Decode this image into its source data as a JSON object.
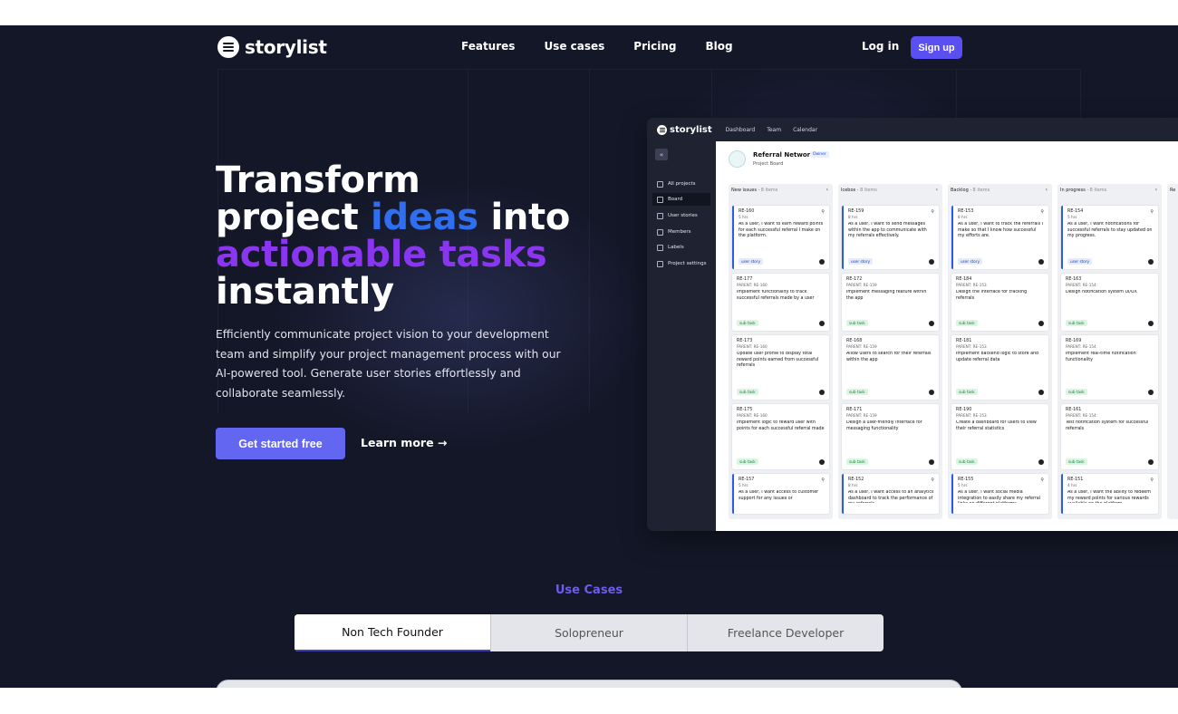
{
  "brand": {
    "name": "storylist"
  },
  "nav": {
    "items": [
      "Features",
      "Use cases",
      "Pricing",
      "Blog"
    ],
    "login": "Log in",
    "signup": "Sign up"
  },
  "hero": {
    "line1": "Transform",
    "line2a": "project ",
    "line2b": "ideas",
    "line2c": " into",
    "line3": "actionable tasks",
    "line4": "instantly",
    "description": "Efficiently communicate project vision to your development team and simplify your project management process with our AI-powered tool. Generate user stories effortlessly and collaborate seamlessly.",
    "cta": "Get started free",
    "learn_more": "Learn more →"
  },
  "colors": {
    "background": "#141727",
    "accent": "#6366f1",
    "blue": "#2f6ef0",
    "purple": "#8a36f0"
  },
  "app_preview": {
    "logo": "storylist",
    "menu": [
      "Dashboard",
      "Team",
      "Calendar"
    ],
    "collapse_icon": "«",
    "sidebar": [
      "All projects",
      "Board",
      "User stories",
      "Members",
      "Labels",
      "Project settings"
    ],
    "project": {
      "title": "Referral Network",
      "badge": "Owner",
      "subtitle": "Project Board"
    },
    "columns": [
      {
        "name": "New issues",
        "count": "8 items",
        "cards": [
          {
            "id": "RE-160",
            "meta": "5 hrs",
            "text": "As a user, I want to earn reward points for each successful referral I make on the platform.",
            "tag": "user story",
            "type": "story"
          },
          {
            "id": "RE-177",
            "meta": "PARENT: RE-160",
            "text": "Implement functionality to track successful referrals made by a user",
            "tag": "sub task",
            "type": "sub"
          },
          {
            "id": "RE-173",
            "meta": "PARENT: RE-160",
            "text": "Update user profile to display total reward points earned from successful referrals",
            "tag": "sub task",
            "type": "sub"
          },
          {
            "id": "RE-175",
            "meta": "PARENT: RE-160",
            "text": "Implement logic to reward user with points for each successful referral made",
            "tag": "sub task",
            "type": "sub"
          },
          {
            "id": "RE-157",
            "meta": "5 hrs",
            "text": "As a user, I want access to customer support for any issues or",
            "tag": "",
            "type": "story"
          }
        ]
      },
      {
        "name": "Icebox",
        "count": "8 items",
        "cards": [
          {
            "id": "RE-159",
            "meta": "8 hrs",
            "text": "As a user, I want to send messages within the app to communicate with my referrals effectively.",
            "tag": "user story",
            "type": "story"
          },
          {
            "id": "RE-172",
            "meta": "PARENT: RE-159",
            "text": "Implement messaging feature within the app",
            "tag": "sub task",
            "type": "sub"
          },
          {
            "id": "RE-168",
            "meta": "PARENT: RE-159",
            "text": "Allow users to search for their referrals within the app",
            "tag": "sub task",
            "type": "sub"
          },
          {
            "id": "RE-171",
            "meta": "PARENT: RE-159",
            "text": "Design a user-friendly interface for messaging functionality",
            "tag": "sub task",
            "type": "sub"
          },
          {
            "id": "RE-152",
            "meta": "8 hrs",
            "text": "As a user, I want access to an analytics dashboard to track the performance of my referrals.",
            "tag": "",
            "type": "story"
          }
        ]
      },
      {
        "name": "Backlog",
        "count": "8 items",
        "cards": [
          {
            "id": "RE-153",
            "meta": "8 hrs",
            "text": "As a user, I want to track the referrals I make so that I know how successful my efforts are.",
            "tag": "user story",
            "type": "story"
          },
          {
            "id": "RE-184",
            "meta": "PARENT: RE-153",
            "text": "Design the interface for tracking referrals",
            "tag": "sub task",
            "type": "sub"
          },
          {
            "id": "RE-181",
            "meta": "PARENT: RE-153",
            "text": "Implement backend logic to store and update referral data",
            "tag": "sub task",
            "type": "sub"
          },
          {
            "id": "RE-190",
            "meta": "PARENT: RE-153",
            "text": "Create a dashboard for users to view their referral statistics",
            "tag": "sub task",
            "type": "sub"
          },
          {
            "id": "RE-155",
            "meta": "5 hrs",
            "text": "As a user, I want social media integration to easily share my referral links on different platforms.",
            "tag": "",
            "type": "story"
          }
        ]
      },
      {
        "name": "In progress",
        "count": "8 items",
        "cards": [
          {
            "id": "RE-154",
            "meta": "5 hrs",
            "text": "As a user, I want notifications for successful referrals to stay updated on my progress.",
            "tag": "user story",
            "type": "story"
          },
          {
            "id": "RE-163",
            "meta": "PARENT: RE-154",
            "text": "Design notification system UI/UX",
            "tag": "sub task",
            "type": "sub"
          },
          {
            "id": "RE-169",
            "meta": "PARENT: RE-154",
            "text": "Implement real-time notification functionality",
            "tag": "sub task",
            "type": "sub"
          },
          {
            "id": "RE-161",
            "meta": "PARENT: RE-154",
            "text": "Test notification system for successful referrals",
            "tag": "sub task",
            "type": "sub"
          },
          {
            "id": "RE-151",
            "meta": "4 hrs",
            "text": "As a user, I want the ability to redeem my reward points for various rewards available on the platform.",
            "tag": "",
            "type": "story"
          }
        ]
      },
      {
        "name": "Re",
        "count": "",
        "cards": []
      }
    ]
  },
  "use_cases": {
    "title": "Use Cases",
    "tabs": [
      "Non Tech Founder",
      "Solopreneur",
      "Freelance Developer"
    ]
  }
}
